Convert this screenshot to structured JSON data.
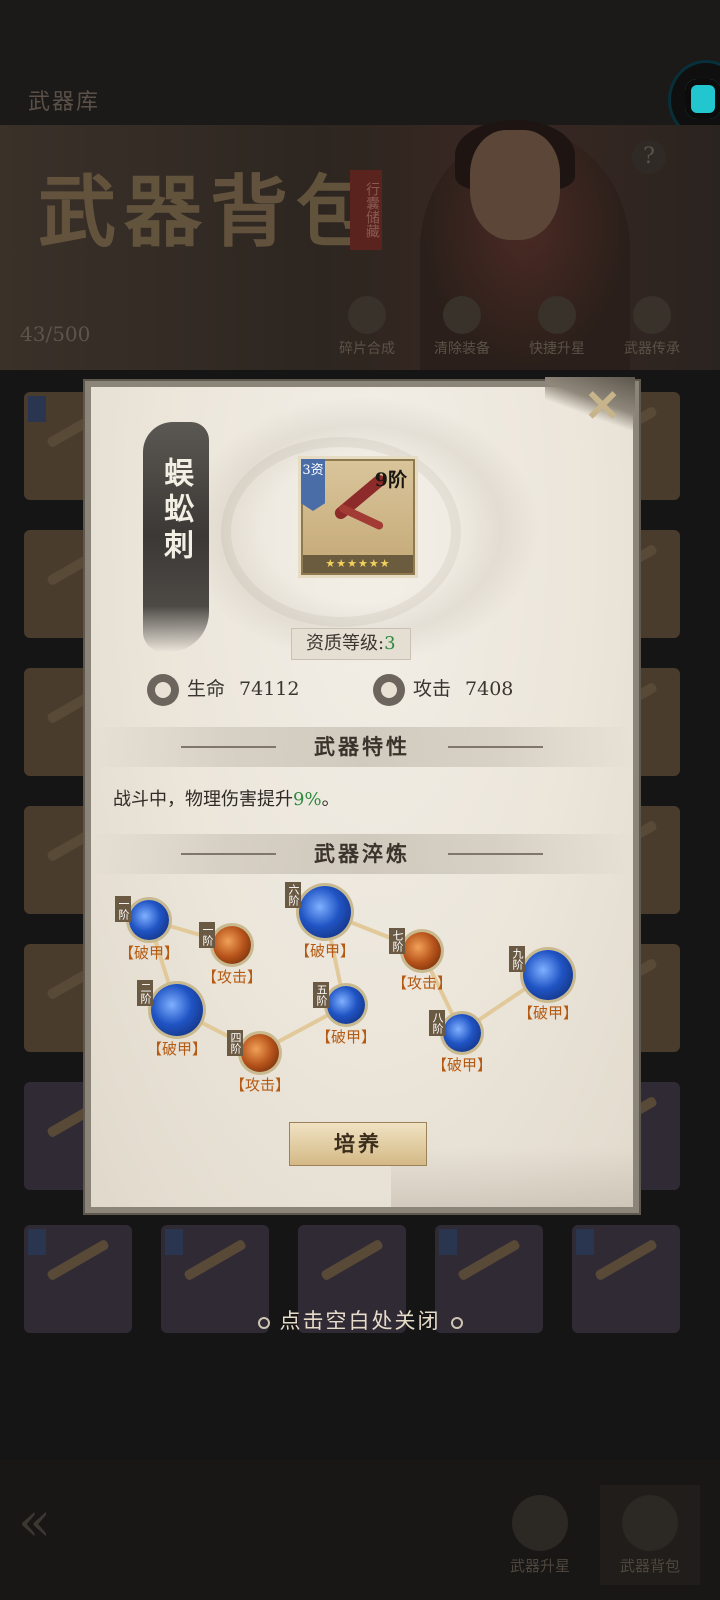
{
  "background": {
    "screen_title": "武器库",
    "banner_title": "武器背包",
    "banner_tag": "行囊储藏",
    "capacity": "43/500",
    "func_buttons": [
      "碎片合成",
      "清除装备",
      "快捷升星",
      "武器传承"
    ],
    "help_icon": "?",
    "bottom_tabs": [
      "武器升星",
      "武器背包"
    ]
  },
  "dialog": {
    "weapon_name": "蜈蚣刺",
    "item": {
      "grade": "3资",
      "tier": "9阶",
      "stars": "★★★★★★"
    },
    "quality_label": "资质等级:",
    "quality_value": "3",
    "stats": [
      {
        "label": "生命",
        "value": "74112",
        "icon": "heart-icon"
      },
      {
        "label": "攻击",
        "value": "7408",
        "icon": "sword-icon"
      }
    ],
    "trait_header": "武器特性",
    "trait_text_before": "战斗中，物理伤害提升",
    "trait_value": "9%",
    "trait_text_after": "。",
    "refine_header": "武器淬炼",
    "refine_nodes": [
      {
        "tier": "一阶",
        "label": "【破甲】",
        "type": "armor-break"
      },
      {
        "tier": "二阶",
        "label": "【破甲】",
        "type": "armor-break"
      },
      {
        "tier": "一阶",
        "label": "【攻击】",
        "type": "attack"
      },
      {
        "tier": "四阶",
        "label": "【攻击】",
        "type": "attack"
      },
      {
        "tier": "六阶",
        "label": "【破甲】",
        "type": "armor-break"
      },
      {
        "tier": "五阶",
        "label": "【破甲】",
        "type": "armor-break"
      },
      {
        "tier": "七阶",
        "label": "【攻击】",
        "type": "attack"
      },
      {
        "tier": "八阶",
        "label": "【破甲】",
        "type": "armor-break"
      },
      {
        "tier": "九阶",
        "label": "【破甲】",
        "type": "armor-break"
      }
    ],
    "train_button": "培养"
  },
  "close_hint": "点击空白处关闭",
  "colors": {
    "highlight_green": "#2e8b3e",
    "label_orange": "#b55a12"
  }
}
